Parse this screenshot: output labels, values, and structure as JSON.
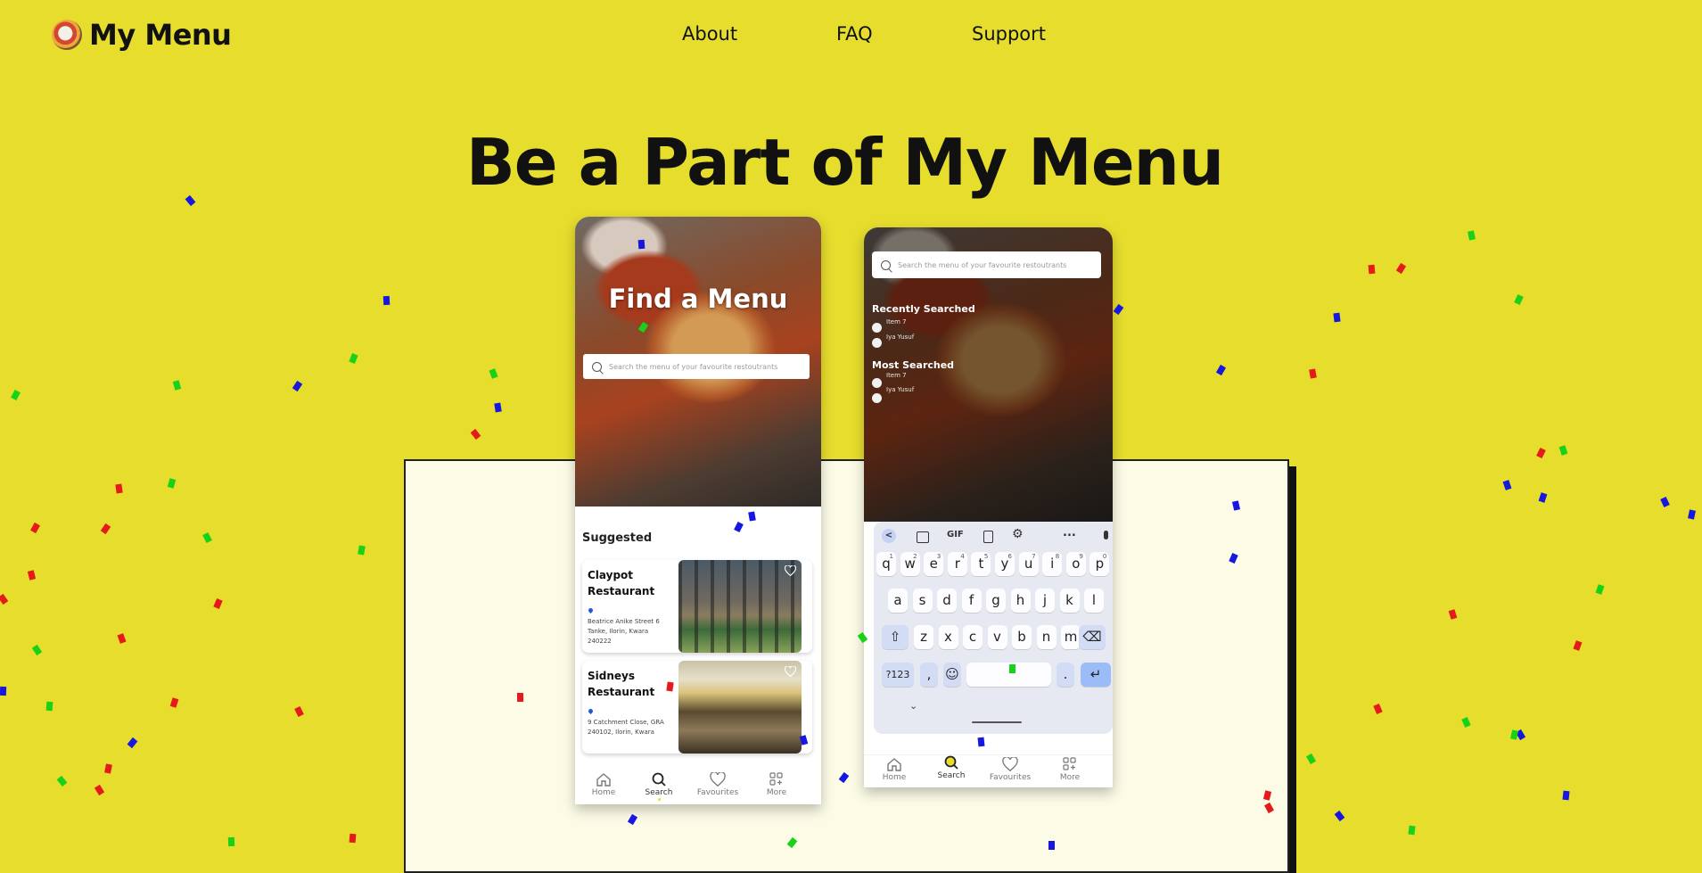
{
  "brand": {
    "name": "My Menu"
  },
  "nav": {
    "about": "About",
    "faq": "FAQ",
    "support": "Support"
  },
  "hero": {
    "title": "Be a Part of My Menu"
  },
  "phone1": {
    "heading": "Find a Menu",
    "search_placeholder": "Search the menu of your favourite restoutrants",
    "suggested_label": "Suggested",
    "cards": [
      {
        "name": "Claypot Restaurant",
        "address": "Beatrice Anike Street 6 Tanke, Ilorin, Kwara 240222"
      },
      {
        "name": "Sidneys Restaurant",
        "address": "9 Catchment Close, GRA 240102, Ilorin, Kwara"
      }
    ],
    "bottom_nav": [
      "Home",
      "Search",
      "Favourites",
      "More"
    ]
  },
  "phone2": {
    "search_placeholder": "Search the menu of your favourite restoutrants",
    "recent_label": "Recently Searched",
    "recent_items": [
      "Item 7",
      "Iya Yusuf"
    ],
    "most_label": "Most Searched",
    "most_items": [
      "Item 7",
      "Iya Yusuf"
    ],
    "keyboard": {
      "toolbar": [
        "<",
        "GIF",
        "..."
      ],
      "row1": [
        "q",
        "w",
        "e",
        "r",
        "t",
        "y",
        "u",
        "i",
        "o",
        "p"
      ],
      "row1_nums": [
        "1",
        "2",
        "3",
        "4",
        "5",
        "6",
        "7",
        "8",
        "9",
        "0"
      ],
      "row2": [
        "a",
        "s",
        "d",
        "f",
        "g",
        "h",
        "j",
        "k",
        "l"
      ],
      "row3": [
        "z",
        "x",
        "c",
        "v",
        "b",
        "n",
        "m"
      ],
      "symbols_key": "?123",
      "comma_key": ",",
      "period_key": "."
    },
    "bottom_nav": [
      "Home",
      "Search",
      "Favourites",
      "More"
    ]
  },
  "colors": {
    "background": "#e6dd2d",
    "panel": "#fbfbe6",
    "accent_blue": "#2456d8"
  }
}
